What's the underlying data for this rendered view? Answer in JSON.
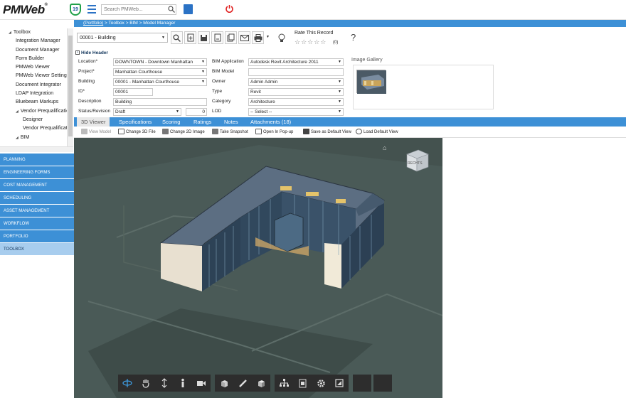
{
  "app": {
    "logo": "PMWeb",
    "badge_count": "19",
    "search_placeholder": "Search PMWeb..."
  },
  "breadcrumb": {
    "root": "(Portfolio)",
    "rest": " > Toolbox > BIM > Model Manager"
  },
  "tree": [
    {
      "label": "Toolbox",
      "level": 0,
      "arrow": "◢"
    },
    {
      "label": "Integration Manager",
      "level": 1
    },
    {
      "label": "Document Manager",
      "level": 1
    },
    {
      "label": "Form Builder",
      "level": 1
    },
    {
      "label": "PMWeb Viewer",
      "level": 1
    },
    {
      "label": "PMWeb Viewer Settings",
      "level": 1
    },
    {
      "label": "Document Integrator",
      "level": 1
    },
    {
      "label": "LDAP Integration",
      "level": 1
    },
    {
      "label": "Bluebeam Markups",
      "level": 1
    },
    {
      "label": "Vendor Prequalification",
      "level": 1,
      "arrow": "◢"
    },
    {
      "label": "Designer",
      "level": 2
    },
    {
      "label": "Vendor Prequalification",
      "level": 2
    },
    {
      "label": "BIM",
      "level": 1,
      "arrow": "◢"
    }
  ],
  "modules": [
    "PLANNING",
    "ENGINEERING FORMS",
    "COST MANAGEMENT",
    "SCHEDULING",
    "ASSET MANAGEMENT",
    "WORKFLOW",
    "PORTFOLIO",
    "TOOLBOX"
  ],
  "toolbar": {
    "record": "00001 - Building",
    "rate_label": "Rate This Record",
    "rate_count": "(0)",
    "help": "?"
  },
  "header_toggle": "Hide Header",
  "form": {
    "location_label": "Location*",
    "location": "DOWNTOWN - Downtown Manhattan",
    "project_label": "Project*",
    "project": "Manhattan Courthouse",
    "building_label": "Building",
    "building": "00001 - Manhattan Courthouse",
    "id_label": "ID*",
    "id": "00001",
    "description_label": "Description",
    "description": "Building",
    "status_label": "Status/Revision",
    "status": "Draft",
    "revision": "0",
    "bim_app_label": "BIM Application",
    "bim_app": "Autodesk Revit Architecture 2011",
    "bim_model_label": "BIM Model",
    "bim_model": "",
    "owner_label": "Owner",
    "owner": "Admin Admin",
    "type_label": "Type",
    "type": "Revit",
    "category_label": "Category",
    "category": "Architecture",
    "lod_label": "LOD",
    "lod": "-- Select --"
  },
  "gallery_label": "Image Gallery",
  "tabs": [
    "3D Viewer",
    "Specifications",
    "Scoring",
    "Ratings",
    "Notes",
    "Attachments (18)"
  ],
  "viewer_toolbar": [
    "View Model",
    "Change 3D File",
    "Change 2D Image",
    "Take Snapshot",
    "Open In Pop-up",
    "Save as Default View",
    "Load Default View"
  ],
  "navcube_label": "RECHTS"
}
